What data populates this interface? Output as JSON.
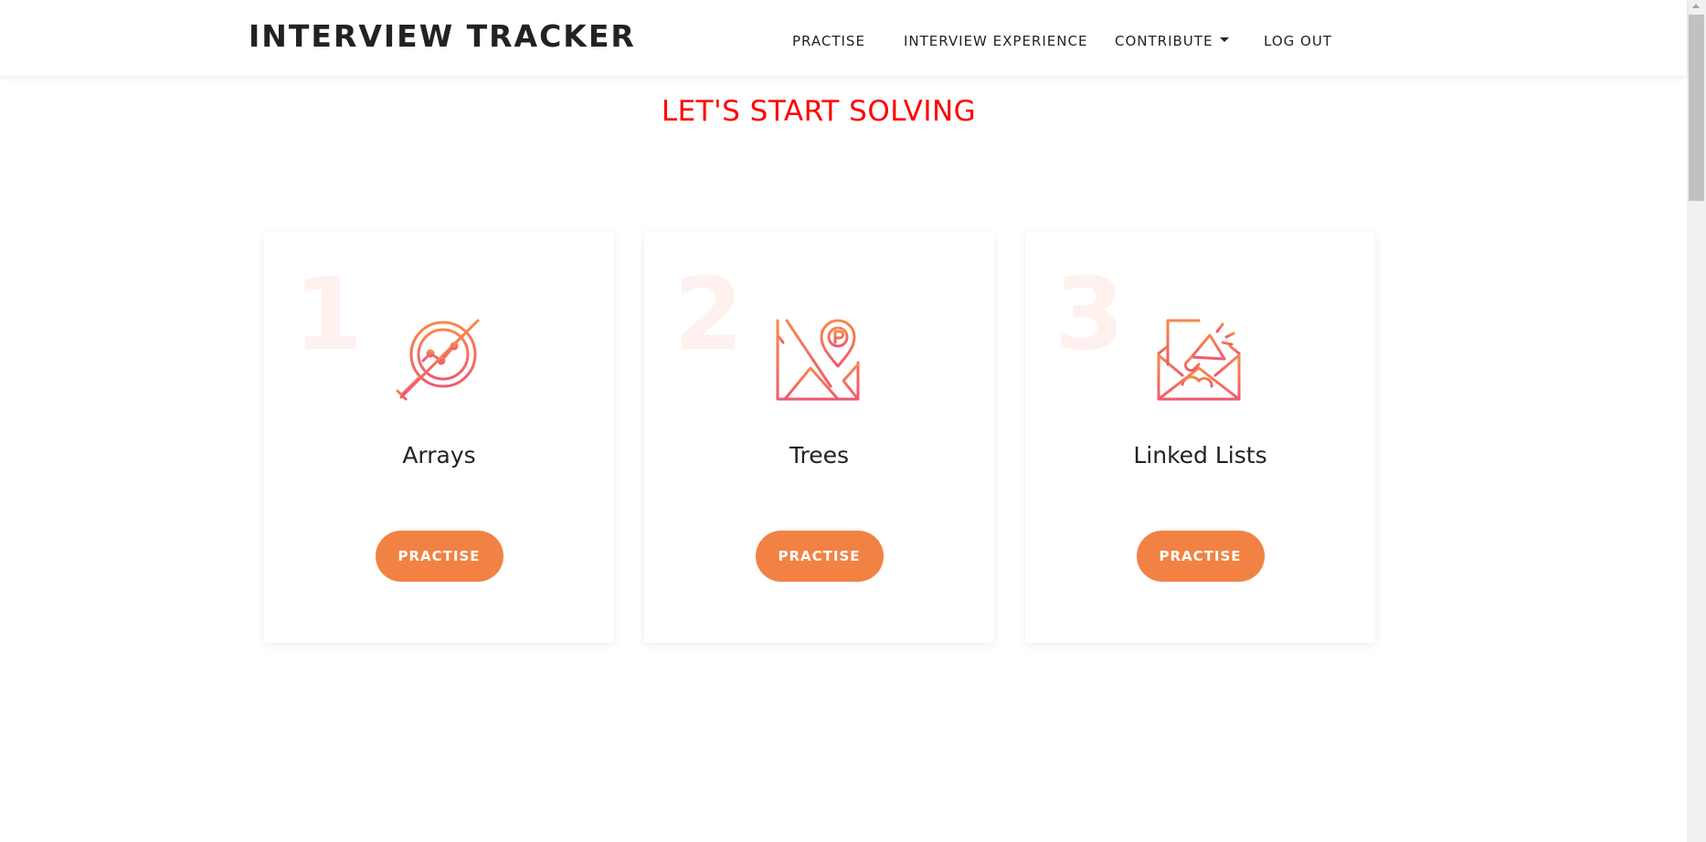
{
  "nav": {
    "brand": "INTERVIEW TRACKER",
    "links": [
      {
        "label": "PRACTISE"
      },
      {
        "label": "INTERVIEW EXPERIENCE"
      },
      {
        "label": "CONTRIBUTE"
      },
      {
        "label": "LOG OUT"
      }
    ]
  },
  "main": {
    "heading": "LET'S START SOLVING",
    "cards": [
      {
        "number": "1",
        "title": "Arrays",
        "button": "PRACTISE",
        "icon": "analytics-magnifier-icon"
      },
      {
        "number": "2",
        "title": "Trees",
        "button": "PRACTISE",
        "icon": "map-location-icon"
      },
      {
        "number": "3",
        "title": "Linked Lists",
        "button": "PRACTISE",
        "icon": "envelope-megaphone-icon"
      }
    ]
  },
  "colors": {
    "accent": "#f28243",
    "heading": "#ff0000",
    "icon_gradient_start": "#f7894a",
    "icon_gradient_end": "#ef5a6f"
  }
}
